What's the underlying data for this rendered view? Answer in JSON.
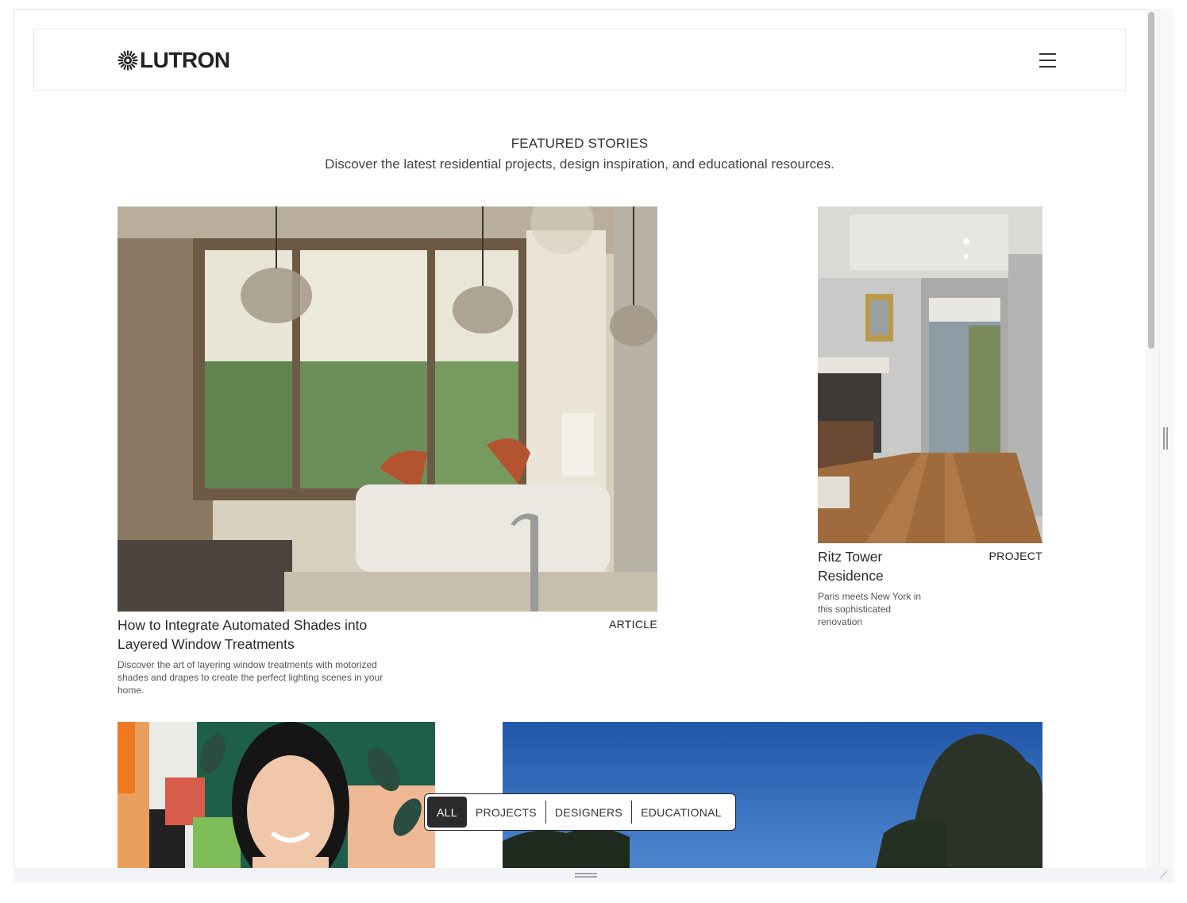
{
  "header": {
    "logo_text": "LUTRON",
    "menu_icon": "hamburger-icon"
  },
  "section": {
    "title": "FEATURED STORIES",
    "subtitle": "Discover the latest residential projects, design inspiration, and educational resources."
  },
  "stories": [
    {
      "title": "How to Integrate Automated Shades into Layered Window Treatments",
      "description": "Discover the art of layering window treatments with motorized shades and drapes to create the perfect lighting scenes in your home.",
      "type": "ARTICLE"
    },
    {
      "title": "Ritz Tower Residence",
      "description": "Paris meets New York in this sophisticated renovation",
      "type": "PROJECT"
    }
  ],
  "filters": {
    "all": "ALL",
    "projects": "PROJECTS",
    "designers": "DESIGNERS",
    "educational": "EDUCATIONAL",
    "active": "ALL"
  },
  "colors": {
    "text": "#222222",
    "active_filter_bg": "#2b2b2b",
    "sky_blue": "#2a63b8"
  }
}
